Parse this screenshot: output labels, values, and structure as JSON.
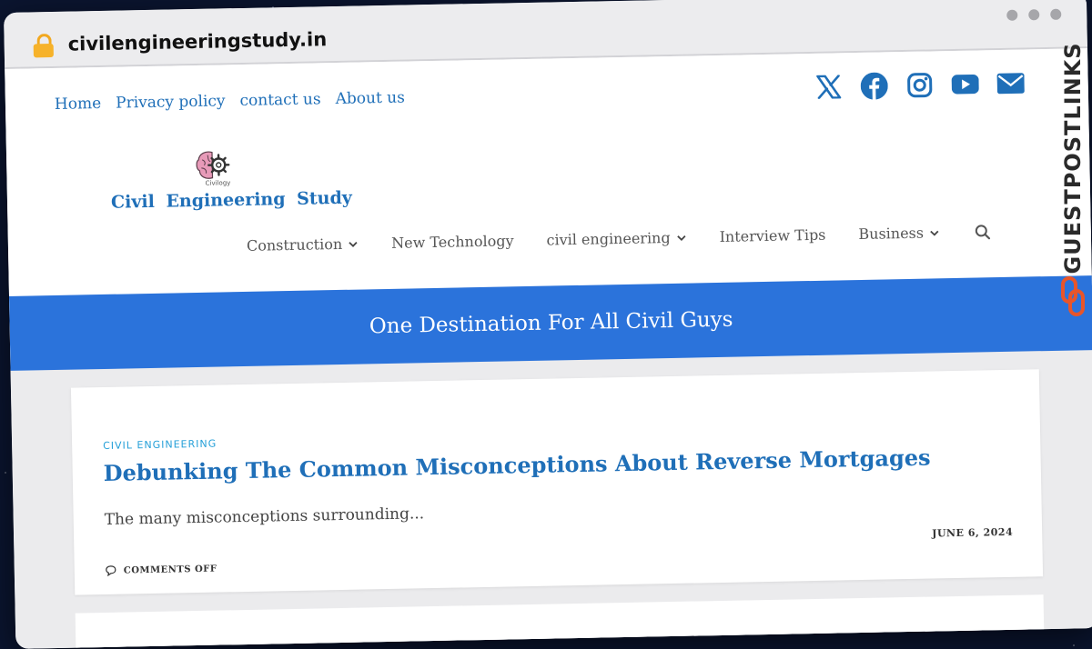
{
  "browser": {
    "url": "civilengineeringstudy.in"
  },
  "top_nav": [
    "Home",
    "Privacy policy",
    "contact us",
    "About us"
  ],
  "social_icons": [
    "x-icon",
    "facebook-icon",
    "instagram-icon",
    "youtube-icon",
    "email-icon"
  ],
  "logo": {
    "small_text": "Civilogy",
    "name": "Civil Engineering Study"
  },
  "main_nav": {
    "construction": "Construction",
    "new_technology": "New Technology",
    "civil_engineering": "civil engineering",
    "interview_tips": "Interview Tips",
    "business": "Business"
  },
  "band": {
    "tagline": "One Destination For All Civil Guys"
  },
  "post": {
    "category": "CIVIL ENGINEERING",
    "title": "Debunking The Common Misconceptions About Reverse Mortgages",
    "excerpt": "The many misconceptions surrounding...",
    "date": "JUNE 6, 2024",
    "comments": "COMMENTS OFF"
  },
  "badge": {
    "text": "GUESTPOSTLINKS"
  },
  "colors": {
    "accent": "#2b73db",
    "link": "#1f6fb8",
    "category": "#26a0d8",
    "badge_orange": "#e8552a"
  }
}
